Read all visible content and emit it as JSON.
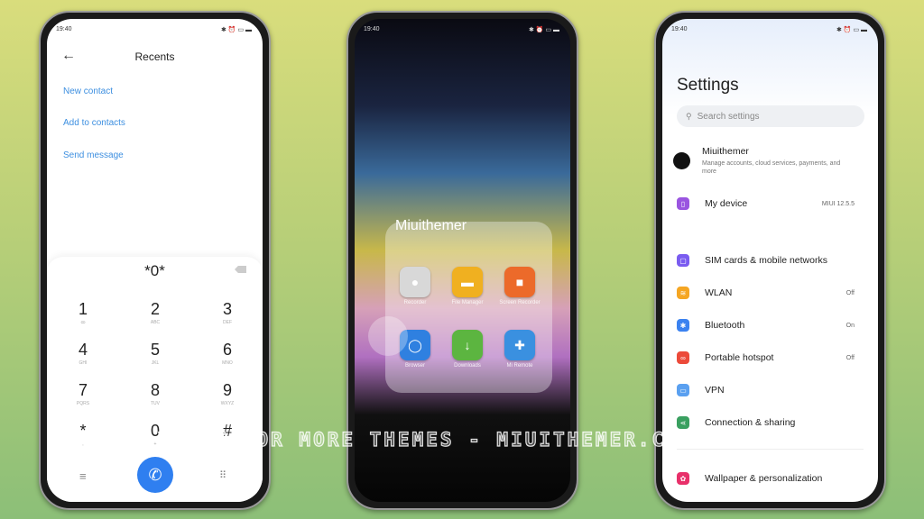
{
  "status": {
    "time": "19:40",
    "icons": [
      "bluetooth-icon",
      "alarm-icon",
      "sim-icon",
      "battery-icon"
    ]
  },
  "dialer": {
    "title": "Recents",
    "links": [
      "New contact",
      "Add to contacts",
      "Send message"
    ],
    "number": "*0*",
    "keys": [
      {
        "d": "1",
        "l": "ꝏ"
      },
      {
        "d": "2",
        "l": "ABC"
      },
      {
        "d": "3",
        "l": "DEF"
      },
      {
        "d": "4",
        "l": "GHI"
      },
      {
        "d": "5",
        "l": "JKL"
      },
      {
        "d": "6",
        "l": "MNO"
      },
      {
        "d": "7",
        "l": "PQRS"
      },
      {
        "d": "8",
        "l": "TUV"
      },
      {
        "d": "9",
        "l": "WXYZ"
      },
      {
        "d": "*",
        "l": ","
      },
      {
        "d": "0",
        "l": "+"
      },
      {
        "d": "#",
        "l": ""
      }
    ],
    "call_color": "#2f7ff0"
  },
  "home": {
    "folder_name": "Miuithemer",
    "apps": [
      {
        "name": "Recorder",
        "color": "#d8d8d8"
      },
      {
        "name": "File Manager",
        "color": "#f0b020"
      },
      {
        "name": "Screen Recorder",
        "color": "#ec6a2a"
      },
      {
        "name": "Browser",
        "color": "#2f80e0"
      },
      {
        "name": "Downloads",
        "color": "#5cb540"
      },
      {
        "name": "Mi Remote",
        "color": "#3a90e0"
      }
    ]
  },
  "settings": {
    "title": "Settings",
    "search_placeholder": "Search settings",
    "account": {
      "name": "Miuithemer",
      "desc": "Manage accounts, cloud services, payments, and more"
    },
    "device": {
      "label": "My device",
      "value": "MIUI 12.5.5",
      "color": "#9a55e0"
    },
    "items": [
      {
        "label": "SIM cards & mobile networks",
        "value": "",
        "color": "#7a5cf0"
      },
      {
        "label": "WLAN",
        "value": "Off",
        "color": "#f5a623"
      },
      {
        "label": "Bluetooth",
        "value": "On",
        "color": "#3b82f0"
      },
      {
        "label": "Portable hotspot",
        "value": "Off",
        "color": "#ec4a3a"
      },
      {
        "label": "VPN",
        "value": "",
        "color": "#5aa0f0"
      },
      {
        "label": "Connection & sharing",
        "value": "",
        "color": "#3aa060"
      }
    ],
    "wallpaper": {
      "label": "Wallpaper & personalization",
      "color": "#e8306a"
    }
  },
  "watermark": "VISIT FOR MORE THEMES - MIUITHEMER.COM"
}
